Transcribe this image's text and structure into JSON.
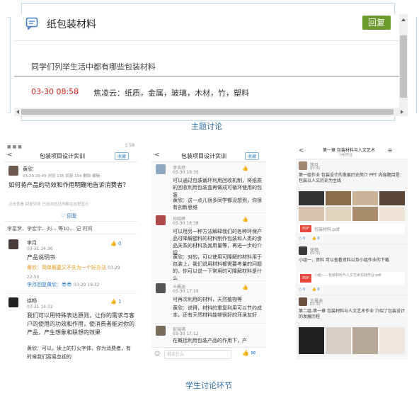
{
  "topic_panel": {
    "title": "纸包装材料",
    "reply_label": "回复",
    "question": "同学们列举生活中都有哪些包装材料",
    "answer_time": "03-30 08:58",
    "answer_text": "焦凌云：纸质，金属，玻璃，木材，竹，塑料",
    "caption": "主题讨论"
  },
  "shot1": {
    "back": "<",
    "title": "包装项目设计实训",
    "badge": "收藏",
    "poster_name": "黄欣",
    "poster_meta": "03-29 20:49  浏览 135  回复 104  删除  编辑",
    "post_question": "如何将产品的功效和作用明确地告诉消费者？",
    "post_note": "点击查看 回复列表 已经浏览过的都在这里显示",
    "reply_icon_label": "回复",
    "participants": "李星梦、李宏宇、刘… 等10…  记 时间",
    "r1_name": "李月",
    "r1_meta": "03-31 14:36",
    "r1_text": "产品说明书",
    "r1_sub": "黄欣：简单概要又不失为一个好办法",
    "r1_sub_time": "03-29 22:50",
    "r1_reply": "李月回复黄欣：😎😎",
    "r1_reply_time": "03-29 19:32",
    "r1_likes": "0",
    "r2_name": "徐畅",
    "r2_meta": "03-31 14:32",
    "r2_text": "我们可以用特殊表达原则，让你的需求与客户的使用的功效和作用，使消费者能对你的产品，产生想象和联想的效果",
    "r2_sub": "黄欣：可以，读上的打火字体，你为消费者，有时候我们容易忽视的",
    "r2_likes": "1"
  },
  "shot2": {
    "back": "<",
    "title": "包装项目设计实训",
    "badge": "收藏",
    "c1_name": "李浩然",
    "c1_meta": "03-30 19:36",
    "c1_text": "可以通过包装循环利用回收机制，将纸质的回收利用包装盒再做成可循环使用的包装",
    "c1_sub": "黄欣：这一点儿很多同学都没想到，你很有创新思维",
    "c2_name": "孙晓婷",
    "c2_meta": "03-30 18:38",
    "c2_text": "可以用另一种方法解释我们的各种环保产品可降解塑料的材料制作包装和人类的食品关系的材料及其用量等，再进一步的介绍",
    "c2_sub": "黄欣：对的，可以使用可降解的材料用于包装上，我们说用材料都需要考量的问题的，你可以说一下常用的可降解材料是什么",
    "c3_name": "王晨迪",
    "c3_meta": "03-30 17:19",
    "c3_text": "可再次利用的材料，天然植物等",
    "c3_sub": "黄欣：说得，材料的重复利用可以节约成本，还有天然材料能够很好的环境友好",
    "c4_name": "彭瑞琪",
    "c4_meta": "03-30 17:12",
    "c4_text": "在概括利用包装产品的作用下，产",
    "input_placeholder": "说点什么"
  },
  "shot3": {
    "back": "<",
    "title": "第一章 包装材料与人文艺术",
    "subtitle": "小组作业",
    "p1_name": "李月",
    "p1_meta": "03-31",
    "p1_text": "第一组作业 包装设计的发展历史简介 PPT 内容题目是：包装以人文历史为主线",
    "pdf_label": "包装材料.pdf",
    "p2_name": "徐畅",
    "p2_meta": "03-31",
    "p2_text": "小组一，资料 可以查看资料以及小组作业的下载",
    "pdf2_label": "小组——包装材料与人文艺术实践作业.pdf",
    "p3_name": "王晨迪",
    "p3_meta": "03-31",
    "p3_text": "第二组-第一章 包装材料与人文艺术作业 介绍了包装设计的发展历程"
  },
  "student_caption": "学生讨论环节"
}
